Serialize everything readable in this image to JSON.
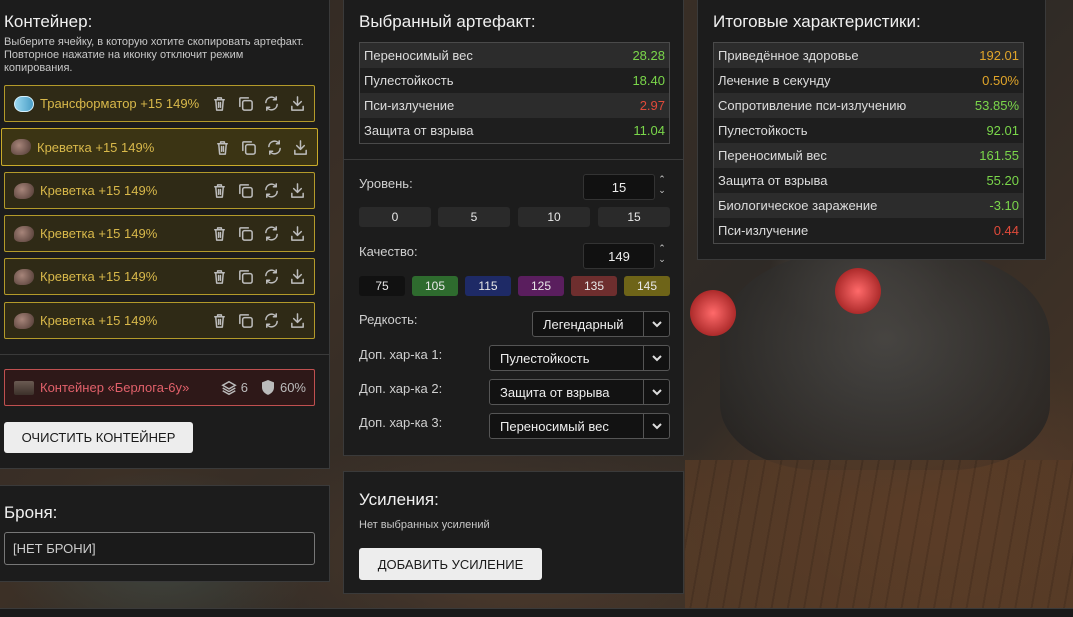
{
  "container": {
    "title": "Контейнер:",
    "hint": "Выберите ячейку, в которую хотите скопировать артефакт. Повторное нажатие на иконку отключит режим копирования.",
    "slots": [
      {
        "label": "Трансформатор +15 149%",
        "icon": "transformer-artifact-icon"
      },
      {
        "label": "Креветка +15 149%",
        "icon": "shrimp-artifact-icon"
      },
      {
        "label": "Креветка +15 149%",
        "icon": "shrimp-artifact-icon"
      },
      {
        "label": "Креветка +15 149%",
        "icon": "shrimp-artifact-icon"
      },
      {
        "label": "Креветка +15 149%",
        "icon": "shrimp-artifact-icon"
      },
      {
        "label": "Креветка +15 149%",
        "icon": "shrimp-artifact-icon"
      }
    ],
    "selected_slot": 1,
    "info": {
      "name": "Контейнер «Берлога-6у»",
      "slots_count": "6",
      "protection": "60%"
    },
    "clear_button": "ОЧИСТИТЬ КОНТЕЙНЕР",
    "accent": "#c9ab2a"
  },
  "armor": {
    "title": "Броня:",
    "value": "[НЕТ БРОНИ]"
  },
  "artifact": {
    "title": "Выбранный артефакт:",
    "stats": [
      {
        "label": "Переносимый вес",
        "value": "28.28",
        "color": "green"
      },
      {
        "label": "Пулестойкость",
        "value": "18.40",
        "color": "green"
      },
      {
        "label": "Пси-излучение",
        "value": "2.97",
        "color": "red"
      },
      {
        "label": "Защита от взрыва",
        "value": "11.04",
        "color": "green"
      }
    ],
    "level_label": "Уровень:",
    "level_value": "15",
    "level_presets": [
      "0",
      "5",
      "10",
      "15"
    ],
    "quality_label": "Качество:",
    "quality_value": "149",
    "quality_presets": [
      {
        "label": "75",
        "color": "#111111"
      },
      {
        "label": "105",
        "color": "#2e6b2e"
      },
      {
        "label": "115",
        "color": "#1e2a66"
      },
      {
        "label": "125",
        "color": "#5a1e5e"
      },
      {
        "label": "135",
        "color": "#6e2e2e"
      },
      {
        "label": "145",
        "color": "#6e6418"
      }
    ],
    "rarity_label": "Редкость:",
    "rarity_value": "Легендарный",
    "extra1_label": "Доп. хар-ка 1:",
    "extra1_value": "Пулестойкость",
    "extra2_label": "Доп. хар-ка 2:",
    "extra2_value": "Защита от взрыва",
    "extra3_label": "Доп. хар-ка 3:",
    "extra3_value": "Переносимый вес"
  },
  "boosts": {
    "title": "Усиления:",
    "empty": "Нет выбранных усилений",
    "add_button": "ДОБАВИТЬ УСИЛЕНИЕ"
  },
  "totals": {
    "title": "Итоговые характеристики:",
    "stats": [
      {
        "label": "Приведённое здоровье",
        "value": "192.01",
        "color": "orange"
      },
      {
        "label": "Лечение в секунду",
        "value": "0.50%",
        "color": "orange"
      },
      {
        "label": "Сопротивление пси-излучению",
        "value": "53.85%",
        "color": "green"
      },
      {
        "label": "Пулестойкость",
        "value": "92.01",
        "color": "green"
      },
      {
        "label": "Переносимый вес",
        "value": "161.55",
        "color": "green"
      },
      {
        "label": "Защита от взрыва",
        "value": "55.20",
        "color": "green"
      },
      {
        "label": "Биологическое заражение",
        "value": "-3.10",
        "color": "green"
      },
      {
        "label": "Пси-излучение",
        "value": "0.44",
        "color": "red"
      }
    ]
  }
}
